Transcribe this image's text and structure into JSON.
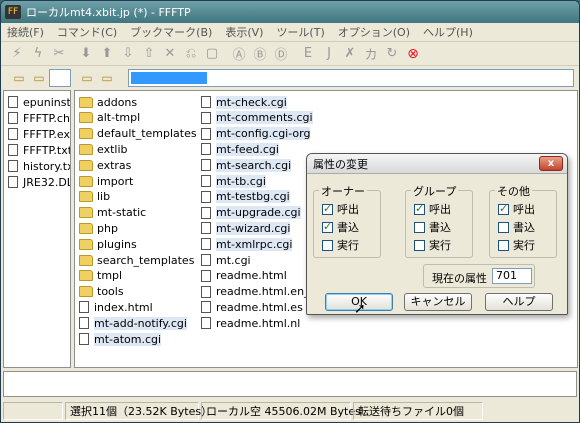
{
  "window": {
    "title": "ローカルmt4.xbit.jp (*) - FFFTP"
  },
  "menu": [
    "接続(F)",
    "コマンド(C)",
    "ブックマーク(B)",
    "表示(V)",
    "ツール(T)",
    "オプション(O)",
    "ヘルプ(H)"
  ],
  "toolbar_icons": [
    "connect-icon",
    "quick-connect-icon",
    "disconnect-icon",
    "download-icon",
    "upload-icon",
    "download-as-icon",
    "upload-mirror-icon",
    "delete-icon",
    "rename-icon",
    "mkdir-icon",
    "ascii-mode-icon",
    "binary-mode-icon",
    "auto-mode-icon",
    "kanji-euc-icon",
    "kanji-jis-icon",
    "no-convert-icon",
    "kana-icon",
    "sync-icon",
    "stop-icon"
  ],
  "local_files": [
    "epuninst.e",
    "FFFTP.chr",
    "FFFTP.exe",
    "FFFTP.txt",
    "history.txt",
    "JRE32.DL"
  ],
  "remote_folders": [
    "addons",
    "alt-tmpl",
    "default_templates",
    "extlib",
    "extras",
    "import",
    "lib",
    "mt-static",
    "php",
    "plugins",
    "search_templates",
    "tmpl",
    "tools"
  ],
  "remote_col1_files": [
    "index.html",
    "mt-add-notify.cgi",
    "mt-atom.cgi"
  ],
  "remote_col2_files": [
    "mt-check.cgi",
    "mt-comments.cgi",
    "mt-config.cgi-org",
    "mt-feed.cgi",
    "mt-search.cgi",
    "mt-tb.cgi",
    "mt-testbg.cgi",
    "mt-upgrade.cgi",
    "mt-wizard.cgi",
    "mt-xmlrpc.cgi",
    "mt.cgi",
    "readme.html",
    "readme.html.en_U",
    "readme.html.es",
    "readme.html.nl"
  ],
  "status": {
    "selection": "選択11個（23.52K Bytes）",
    "local_free": "ローカル空 45506.02M Bytes",
    "queue": "転送待ちファイル0個"
  },
  "dialog": {
    "title": "属性の変更",
    "close": "x",
    "groups": [
      {
        "label": "オーナー",
        "items": [
          {
            "label": "呼出",
            "checked": true
          },
          {
            "label": "書込",
            "checked": true
          },
          {
            "label": "実行",
            "checked": false
          }
        ]
      },
      {
        "label": "グループ",
        "items": [
          {
            "label": "呼出",
            "checked": true
          },
          {
            "label": "書込",
            "checked": false
          },
          {
            "label": "実行",
            "checked": false
          }
        ]
      },
      {
        "label": "その他",
        "items": [
          {
            "label": "呼出",
            "checked": true
          },
          {
            "label": "書込",
            "checked": false
          },
          {
            "label": "実行",
            "checked": false
          }
        ]
      }
    ],
    "current_label": "現在の属性",
    "current_value": "701",
    "ok": "OK",
    "cancel": "キャンセル",
    "help": "ヘルプ"
  }
}
